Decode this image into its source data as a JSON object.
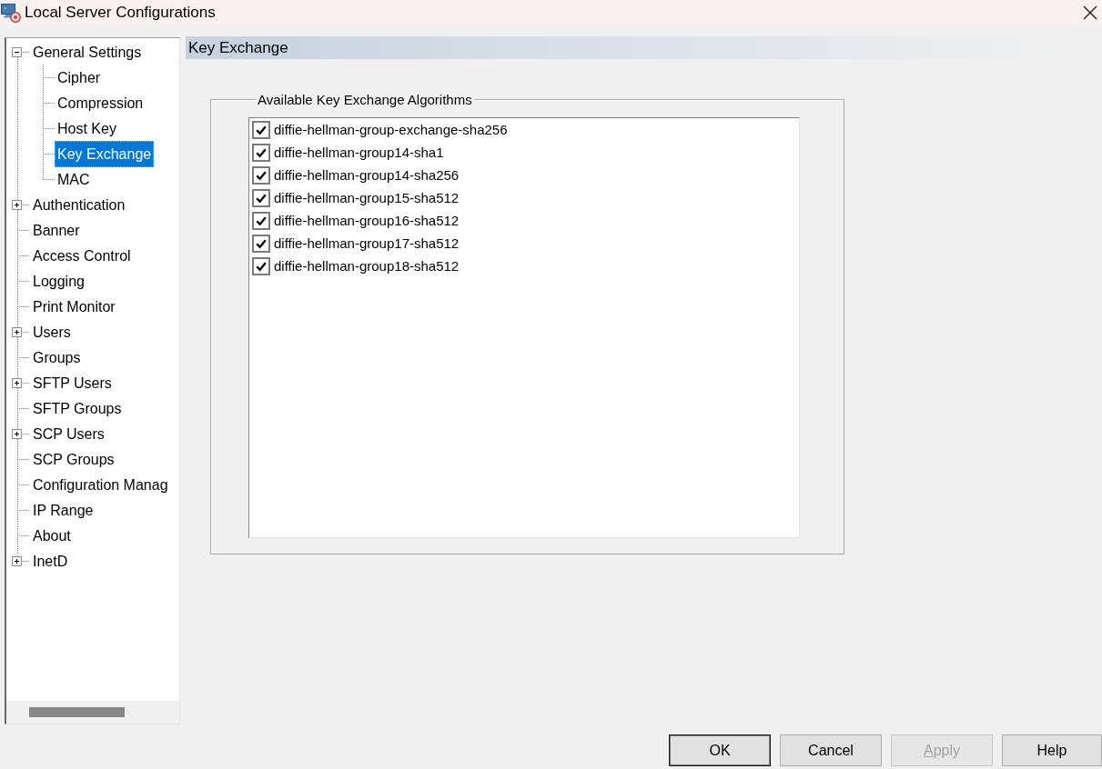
{
  "window": {
    "title": "Local Server Configurations"
  },
  "tree": [
    {
      "label": "General Settings",
      "selected": false,
      "expanded": true,
      "children": [
        {
          "label": "Cipher",
          "selected": false
        },
        {
          "label": "Compression",
          "selected": false
        },
        {
          "label": "Host Key",
          "selected": false
        },
        {
          "label": "Key Exchange",
          "selected": true
        },
        {
          "label": "MAC",
          "selected": false
        }
      ]
    },
    {
      "label": "Authentication",
      "selected": false,
      "expanded": false
    },
    {
      "label": "Banner",
      "selected": false
    },
    {
      "label": "Access Control",
      "selected": false
    },
    {
      "label": "Logging",
      "selected": false
    },
    {
      "label": "Print Monitor",
      "selected": false
    },
    {
      "label": "Users",
      "selected": false,
      "expanded": false
    },
    {
      "label": "Groups",
      "selected": false
    },
    {
      "label": "SFTP Users",
      "selected": false,
      "expanded": false
    },
    {
      "label": "SFTP Groups",
      "selected": false
    },
    {
      "label": "SCP Users",
      "selected": false,
      "expanded": false
    },
    {
      "label": "SCP Groups",
      "selected": false
    },
    {
      "label": "Configuration Manag",
      "selected": false
    },
    {
      "label": "IP Range",
      "selected": false
    },
    {
      "label": "About",
      "selected": false
    },
    {
      "label": "InetD",
      "selected": false,
      "expanded": false
    }
  ],
  "panel": {
    "title": "Key Exchange",
    "group": {
      "legend": "Available Key Exchange Algorithms",
      "algorithms": [
        {
          "name": "diffie-hellman-group-exchange-sha256",
          "checked": true
        },
        {
          "name": "diffie-hellman-group14-sha1",
          "checked": true
        },
        {
          "name": "diffie-hellman-group14-sha256",
          "checked": true
        },
        {
          "name": "diffie-hellman-group15-sha512",
          "checked": true
        },
        {
          "name": "diffie-hellman-group16-sha512",
          "checked": true
        },
        {
          "name": "diffie-hellman-group17-sha512",
          "checked": true
        },
        {
          "name": "diffie-hellman-group18-sha512",
          "checked": true
        }
      ]
    }
  },
  "buttons": [
    {
      "label": "OK",
      "default": true,
      "disabled": false,
      "underlined_access_key": false
    },
    {
      "label": "Cancel",
      "default": false,
      "disabled": false,
      "underlined_access_key": false
    },
    {
      "label": "Apply",
      "default": false,
      "disabled": true,
      "underlined_access_key": true
    },
    {
      "label": "Help",
      "default": false,
      "disabled": false,
      "underlined_access_key": false
    }
  ]
}
